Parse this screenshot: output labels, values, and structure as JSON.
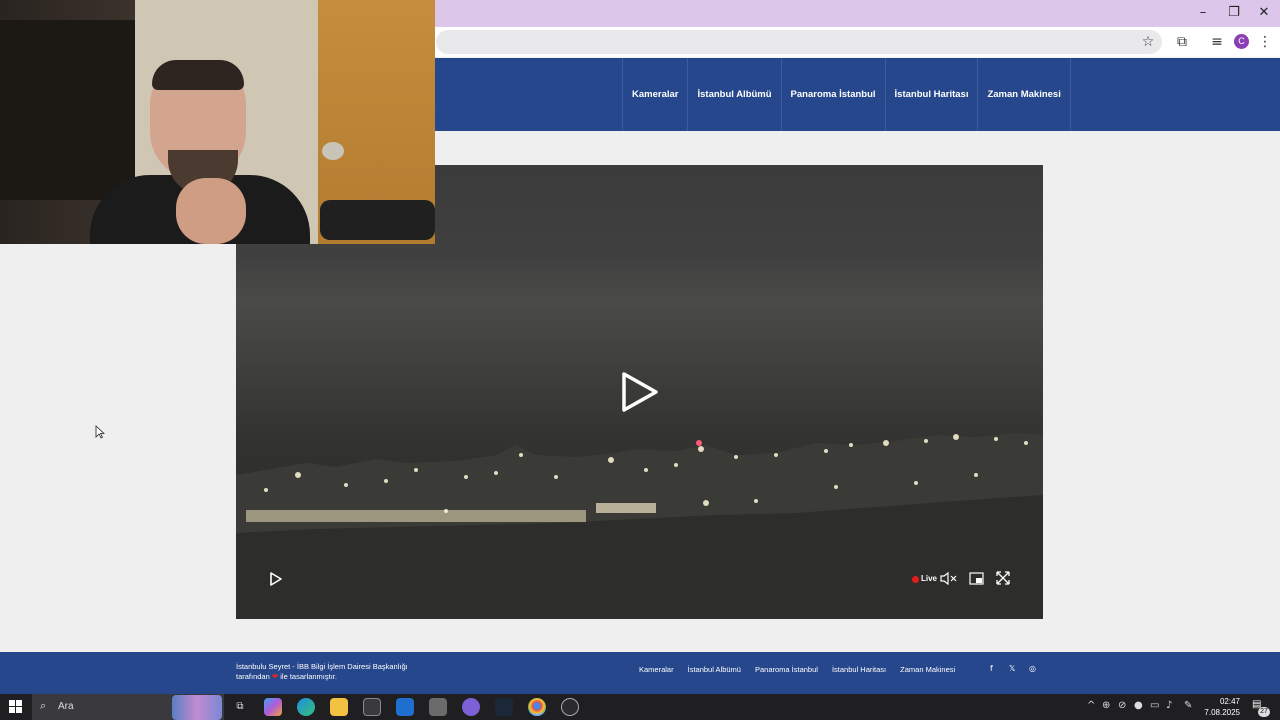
{
  "window": {
    "minimize_icon": "minimize-icon",
    "restore_icon": "restore-icon",
    "close_icon": "close-icon"
  },
  "toolbar": {
    "profile_initial": "C"
  },
  "site": {
    "nav": [
      "Kameralar",
      "İstanbul Albümü",
      "Panaroma İstanbul",
      "İstanbul Haritası",
      "Zaman Makinesi"
    ]
  },
  "player": {
    "live_label": "Live"
  },
  "footer": {
    "credit_line1": "İstanbulu Seyret - İBB Bilgi İşlem Dairesi Başkanlığı",
    "credit_line2_before": "tarafından",
    "credit_heart": "❤",
    "credit_line2_after": "ile tasarlanmıştır.",
    "links": [
      "Kameralar",
      "İstanbul Albümü",
      "Panaroma İstanbul",
      "İstanbul Haritası",
      "Zaman Makinesi"
    ],
    "social": [
      "f",
      "𝕏",
      "◎"
    ]
  },
  "taskbar": {
    "search_placeholder": "Ara",
    "time": "02:47",
    "date": "7.08.2025",
    "notifications": "27"
  },
  "colors": {
    "header_blue": "#26478b",
    "title_bar": "#dcc7ea",
    "live_red": "#e21b1b"
  }
}
